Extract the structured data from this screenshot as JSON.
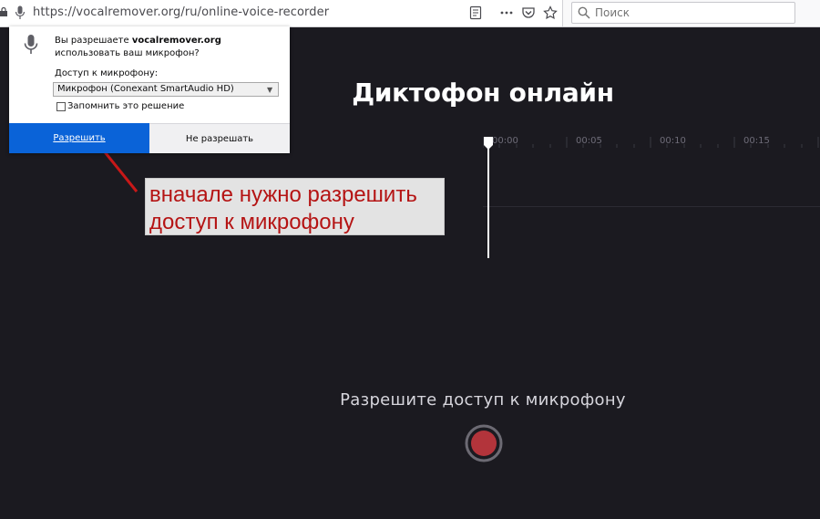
{
  "browser": {
    "url": "https://vocalremover.org/ru/online-voice-recorder",
    "search_placeholder": "Поиск"
  },
  "permission_popup": {
    "question_prefix": "Вы разрешаете ",
    "site": "vocalremover.org",
    "question_suffix": " использовать ваш микрофон?",
    "access_label": "Доступ к микрофону:",
    "device_selected": "Микрофон (Conexant SmartAudio HD)",
    "remember_label": "Запомнить это решение",
    "remember_checked": false,
    "allow_button": "Разрешить",
    "deny_button": "Не разрешать",
    "allow_color": "#0a63d8"
  },
  "page": {
    "title": "Диктофон онлайн",
    "timeline_ticks": [
      "00:00",
      "00:05",
      "00:10",
      "00:15"
    ],
    "mic_status": "Разрешите доступ к микрофону",
    "record_color": "#b3343b"
  },
  "annotation": {
    "line1": "вначале нужно разрешить",
    "line2": "доступ к микрофону",
    "text_color": "#b51414"
  }
}
